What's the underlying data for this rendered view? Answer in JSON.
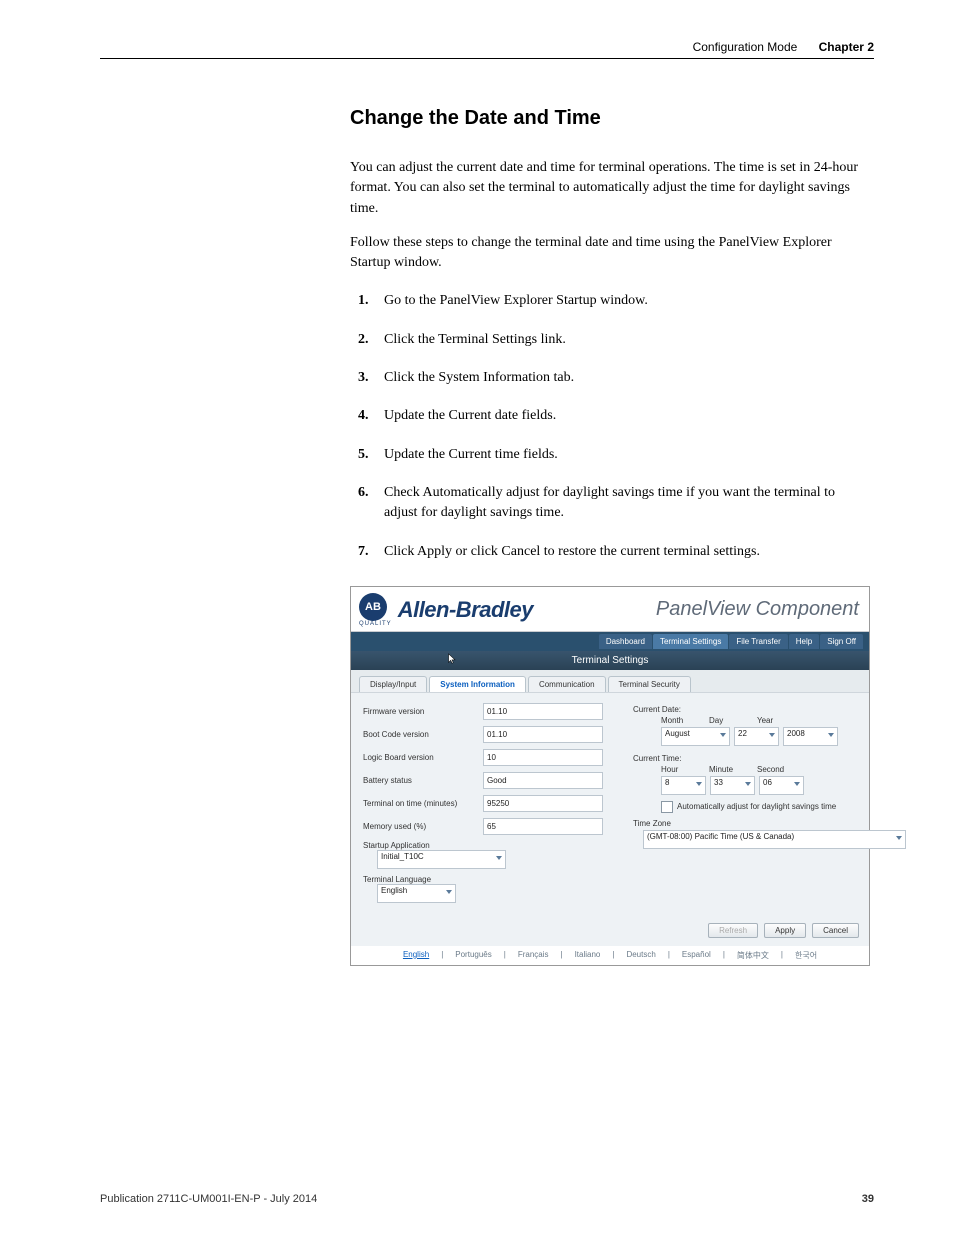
{
  "header": {
    "section": "Configuration Mode",
    "chapter": "Chapter 2"
  },
  "title": "Change the Date and Time",
  "para1": "You can adjust the current date and time for terminal operations. The time is set in 24-hour format. You can also set the terminal to automatically adjust the time for daylight savings time.",
  "para2": "Follow these steps to change the terminal date and time using the PanelView Explorer Startup window.",
  "steps": [
    "Go to the PanelView Explorer Startup window.",
    "Click the Terminal Settings link.",
    "Click the System Information tab.",
    "Update the Current date fields.",
    "Update the Current time fields.",
    "Check Automatically adjust for daylight savings time if you want the terminal to adjust for daylight savings time.",
    "Click Apply or click Cancel to restore the current terminal settings."
  ],
  "app": {
    "brand_badge": "AB",
    "brand_sub": "QUALITY",
    "brand": "Allen-Bradley",
    "product": "PanelView Component",
    "nav": {
      "dashboard": "Dashboard",
      "terminal_settings": "Terminal Settings",
      "file_transfer": "File Transfer",
      "help": "Help",
      "sign_off": "Sign Off"
    },
    "panel_title": "Terminal Settings",
    "tabs": {
      "display_input": "Display/Input",
      "system_information": "System Information",
      "communication": "Communication",
      "terminal_security": "Terminal Security"
    },
    "left_fields": {
      "firmware_label": "Firmware version",
      "firmware_value": "01.10",
      "bootcode_label": "Boot Code version",
      "bootcode_value": "01.10",
      "logicboard_label": "Logic Board version",
      "logicboard_value": "10",
      "battery_label": "Battery status",
      "battery_value": "Good",
      "ontime_label": "Terminal on time (minutes)",
      "ontime_value": "95250",
      "memory_label": "Memory used (%)",
      "memory_value": "65",
      "startup_label": "Startup Application",
      "startup_value": "Initial_T10C",
      "termlang_label": "Terminal Language",
      "termlang_value": "English"
    },
    "right_fields": {
      "current_date_label": "Current Date:",
      "month_label": "Month",
      "day_label": "Day",
      "year_label": "Year",
      "month_value": "August",
      "day_value": "22",
      "year_value": "2008",
      "current_time_label": "Current Time:",
      "hour_label": "Hour",
      "minute_label": "Minute",
      "second_label": "Second",
      "hour_value": "8",
      "minute_value": "33",
      "second_value": "06",
      "dst_label": "Automatically adjust for daylight savings time",
      "tz_label": "Time Zone",
      "tz_value": "(GMT-08:00) Pacific Time (US & Canada)"
    },
    "actions": {
      "refresh": "Refresh",
      "apply": "Apply",
      "cancel": "Cancel"
    },
    "langs": {
      "english": "English",
      "portugues": "Português",
      "francais": "Français",
      "italiano": "Italiano",
      "deutsch": "Deutsch",
      "espanol": "Español",
      "chinese": "简体中文",
      "korean": "한국어"
    }
  },
  "footer": {
    "publication": "Publication 2711C-UM001I-EN-P - July 2014",
    "page": "39"
  }
}
